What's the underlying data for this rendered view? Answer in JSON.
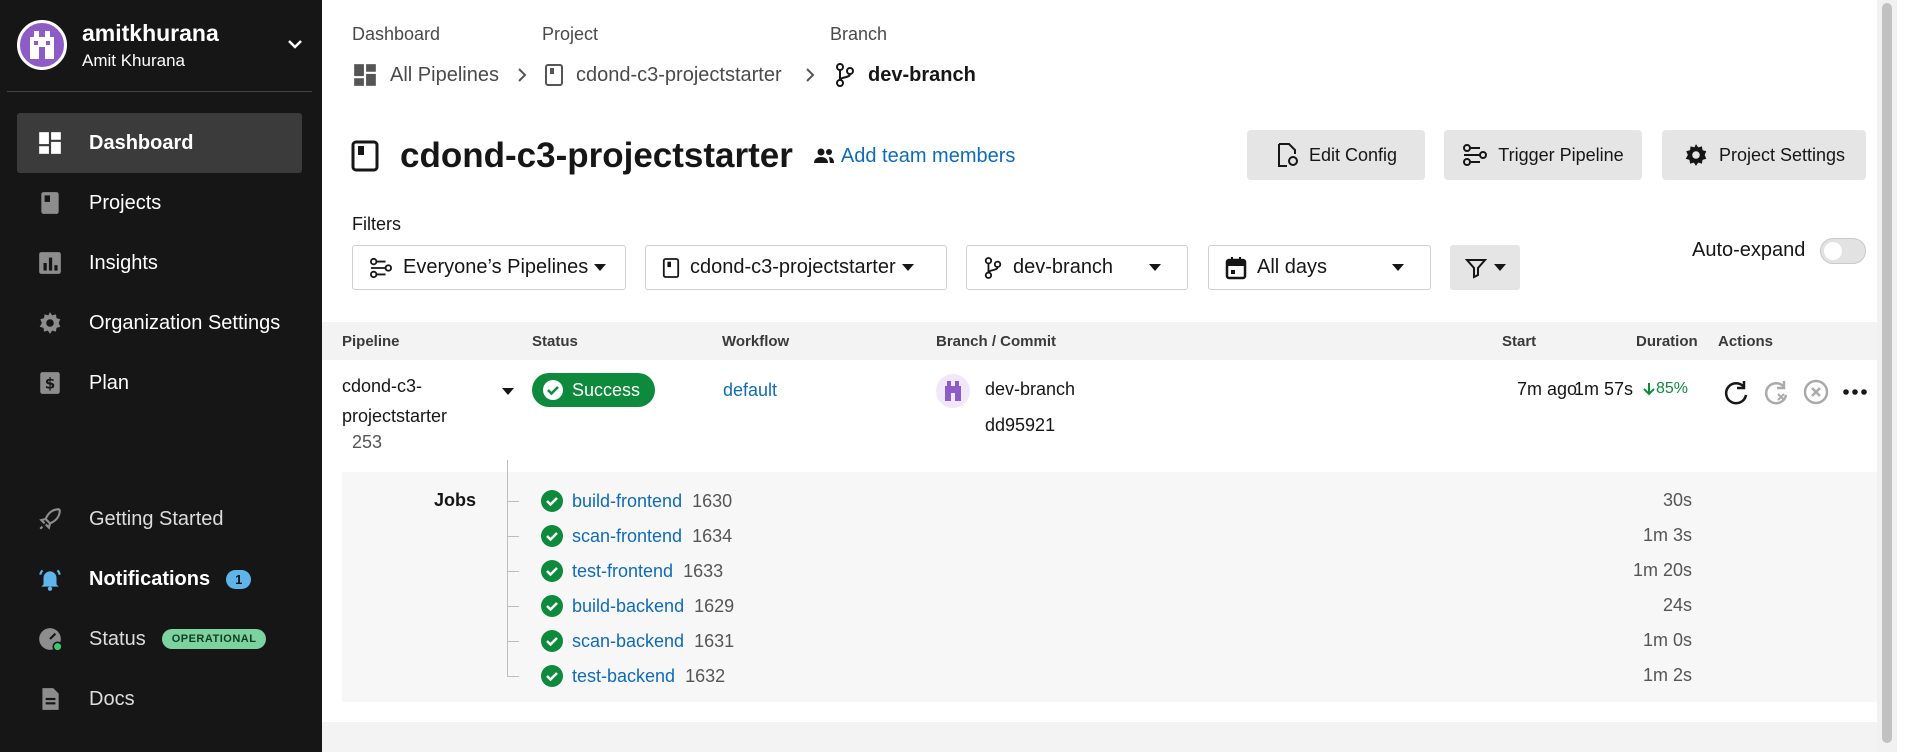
{
  "sidebar": {
    "org_name": "amitkhurana",
    "user_name": "Amit Khurana",
    "nav": [
      {
        "label": "Dashboard",
        "icon": "dashboard-icon",
        "active": true
      },
      {
        "label": "Projects",
        "icon": "projects-icon"
      },
      {
        "label": "Insights",
        "icon": "insights-icon"
      },
      {
        "label": "Organization Settings",
        "icon": "gear-icon"
      },
      {
        "label": "Plan",
        "icon": "plan-icon"
      }
    ],
    "bottom_nav": [
      {
        "label": "Getting Started",
        "icon": "rocket-icon"
      },
      {
        "label": "Notifications",
        "icon": "bell-icon",
        "badge": "1"
      },
      {
        "label": "Status",
        "icon": "status-icon",
        "badge": "OPERATIONAL"
      },
      {
        "label": "Docs",
        "icon": "docs-icon"
      }
    ]
  },
  "breadcrumb": {
    "dashboard_title": "Dashboard",
    "dashboard_value": "All Pipelines",
    "project_title": "Project",
    "project_value": "cdond-c3-projectstarter",
    "branch_title": "Branch",
    "branch_value": "dev-branch"
  },
  "header": {
    "project_name": "cdond-c3-projectstarter",
    "add_team": "Add team members",
    "edit_config": "Edit Config",
    "trigger_pipeline": "Trigger Pipeline",
    "project_settings": "Project Settings"
  },
  "filters": {
    "label": "Filters",
    "pipelines": "Everyone’s Pipelines",
    "project": "cdond-c3-projectstarter",
    "branch": "dev-branch",
    "days": "All days",
    "auto_expand": "Auto-expand"
  },
  "table": {
    "headers": {
      "pipeline": "Pipeline",
      "status": "Status",
      "workflow": "Workflow",
      "branch_commit": "Branch / Commit",
      "start": "Start",
      "duration": "Duration",
      "actions": "Actions"
    },
    "row": {
      "pipeline_line1": "cdond-c3-",
      "pipeline_line2": "projectstarter",
      "number": "253",
      "status": "Success",
      "workflow": "default",
      "branch": "dev-branch",
      "commit": "dd95921",
      "start": "7m ago",
      "duration": "1m 57s",
      "improvement": "85%"
    },
    "jobs_label": "Jobs",
    "jobs": [
      {
        "name": "build-frontend",
        "number": "1630",
        "duration": "30s"
      },
      {
        "name": "scan-frontend",
        "number": "1634",
        "duration": "1m 3s"
      },
      {
        "name": "test-frontend",
        "number": "1633",
        "duration": "1m 20s"
      },
      {
        "name": "build-backend",
        "number": "1629",
        "duration": "24s"
      },
      {
        "name": "scan-backend",
        "number": "1631",
        "duration": "1m 0s"
      },
      {
        "name": "test-backend",
        "number": "1632",
        "duration": "1m 2s"
      }
    ]
  },
  "colors": {
    "sidebar_bg": "#161616",
    "link": "#0f6bb8",
    "success": "#0d8a3c",
    "avatar": "#8e5cc6"
  }
}
